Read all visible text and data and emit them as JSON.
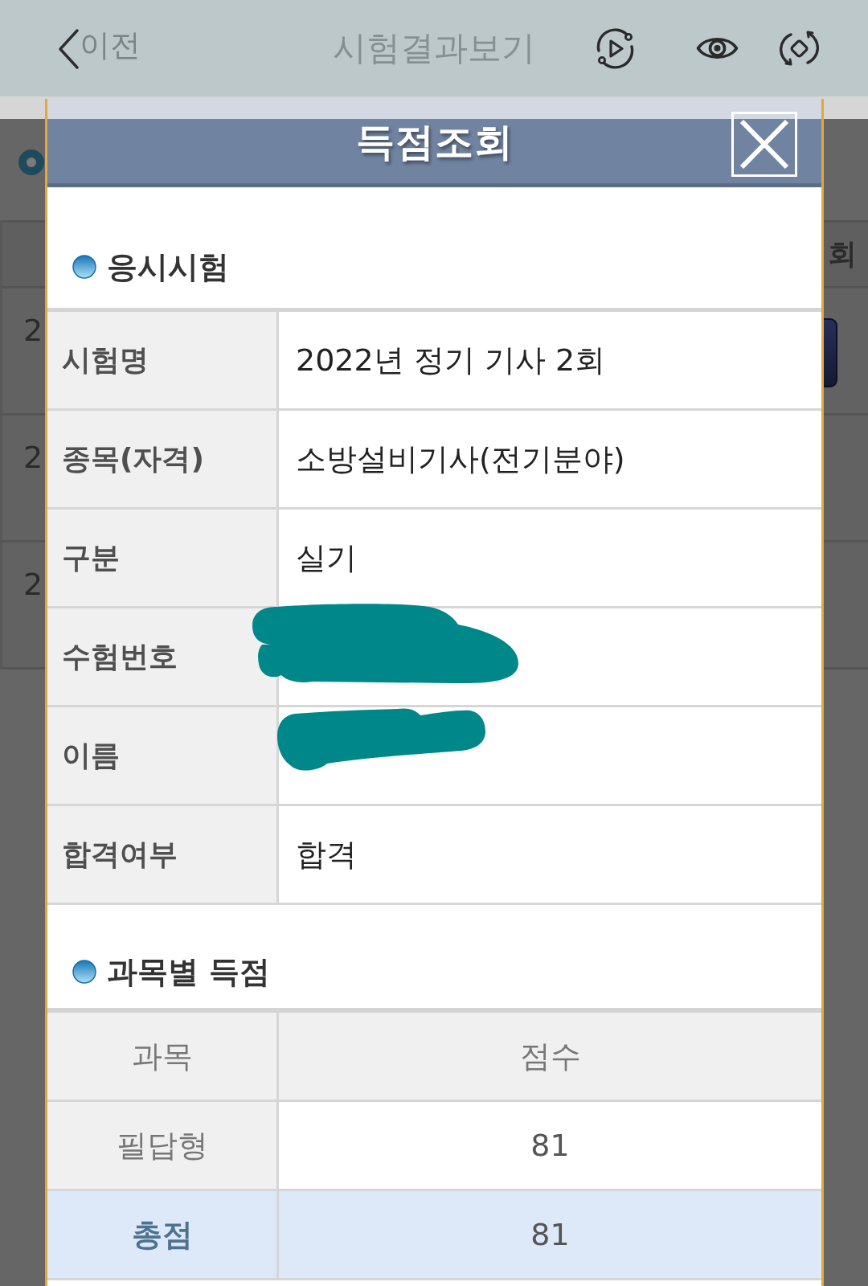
{
  "app_bar": {
    "back_label": "이전",
    "title": "시험결과보기"
  },
  "background_page": {
    "table_header": "회",
    "rows": [
      {
        "cell": "2",
        "has_button": true
      },
      {
        "cell": "2",
        "has_button": false
      },
      {
        "cell": "2",
        "has_button": false
      }
    ]
  },
  "dialog": {
    "title": "득점조회",
    "exam_info": {
      "title": "응시시험",
      "fields": [
        {
          "label": "시험명",
          "value": "2022년 정기 기사 2회",
          "redacted": false
        },
        {
          "label": "종목(자격)",
          "value": "소방설비기사(전기분야)",
          "redacted": false
        },
        {
          "label": "구분",
          "value": "실기",
          "redacted": false
        },
        {
          "label": "수험번호",
          "redacted": true
        },
        {
          "label": "이름",
          "redacted": true
        },
        {
          "label": "합격여부",
          "value": "합격",
          "redacted": false
        }
      ]
    },
    "subject_scores": {
      "title": "과목별 득점",
      "columns": [
        "과목",
        "점수"
      ],
      "rows": [
        {
          "kind": "subject",
          "subject": "필답형",
          "score": "81"
        },
        {
          "kind": "total",
          "subject": "총점",
          "score": "81"
        }
      ]
    }
  }
}
